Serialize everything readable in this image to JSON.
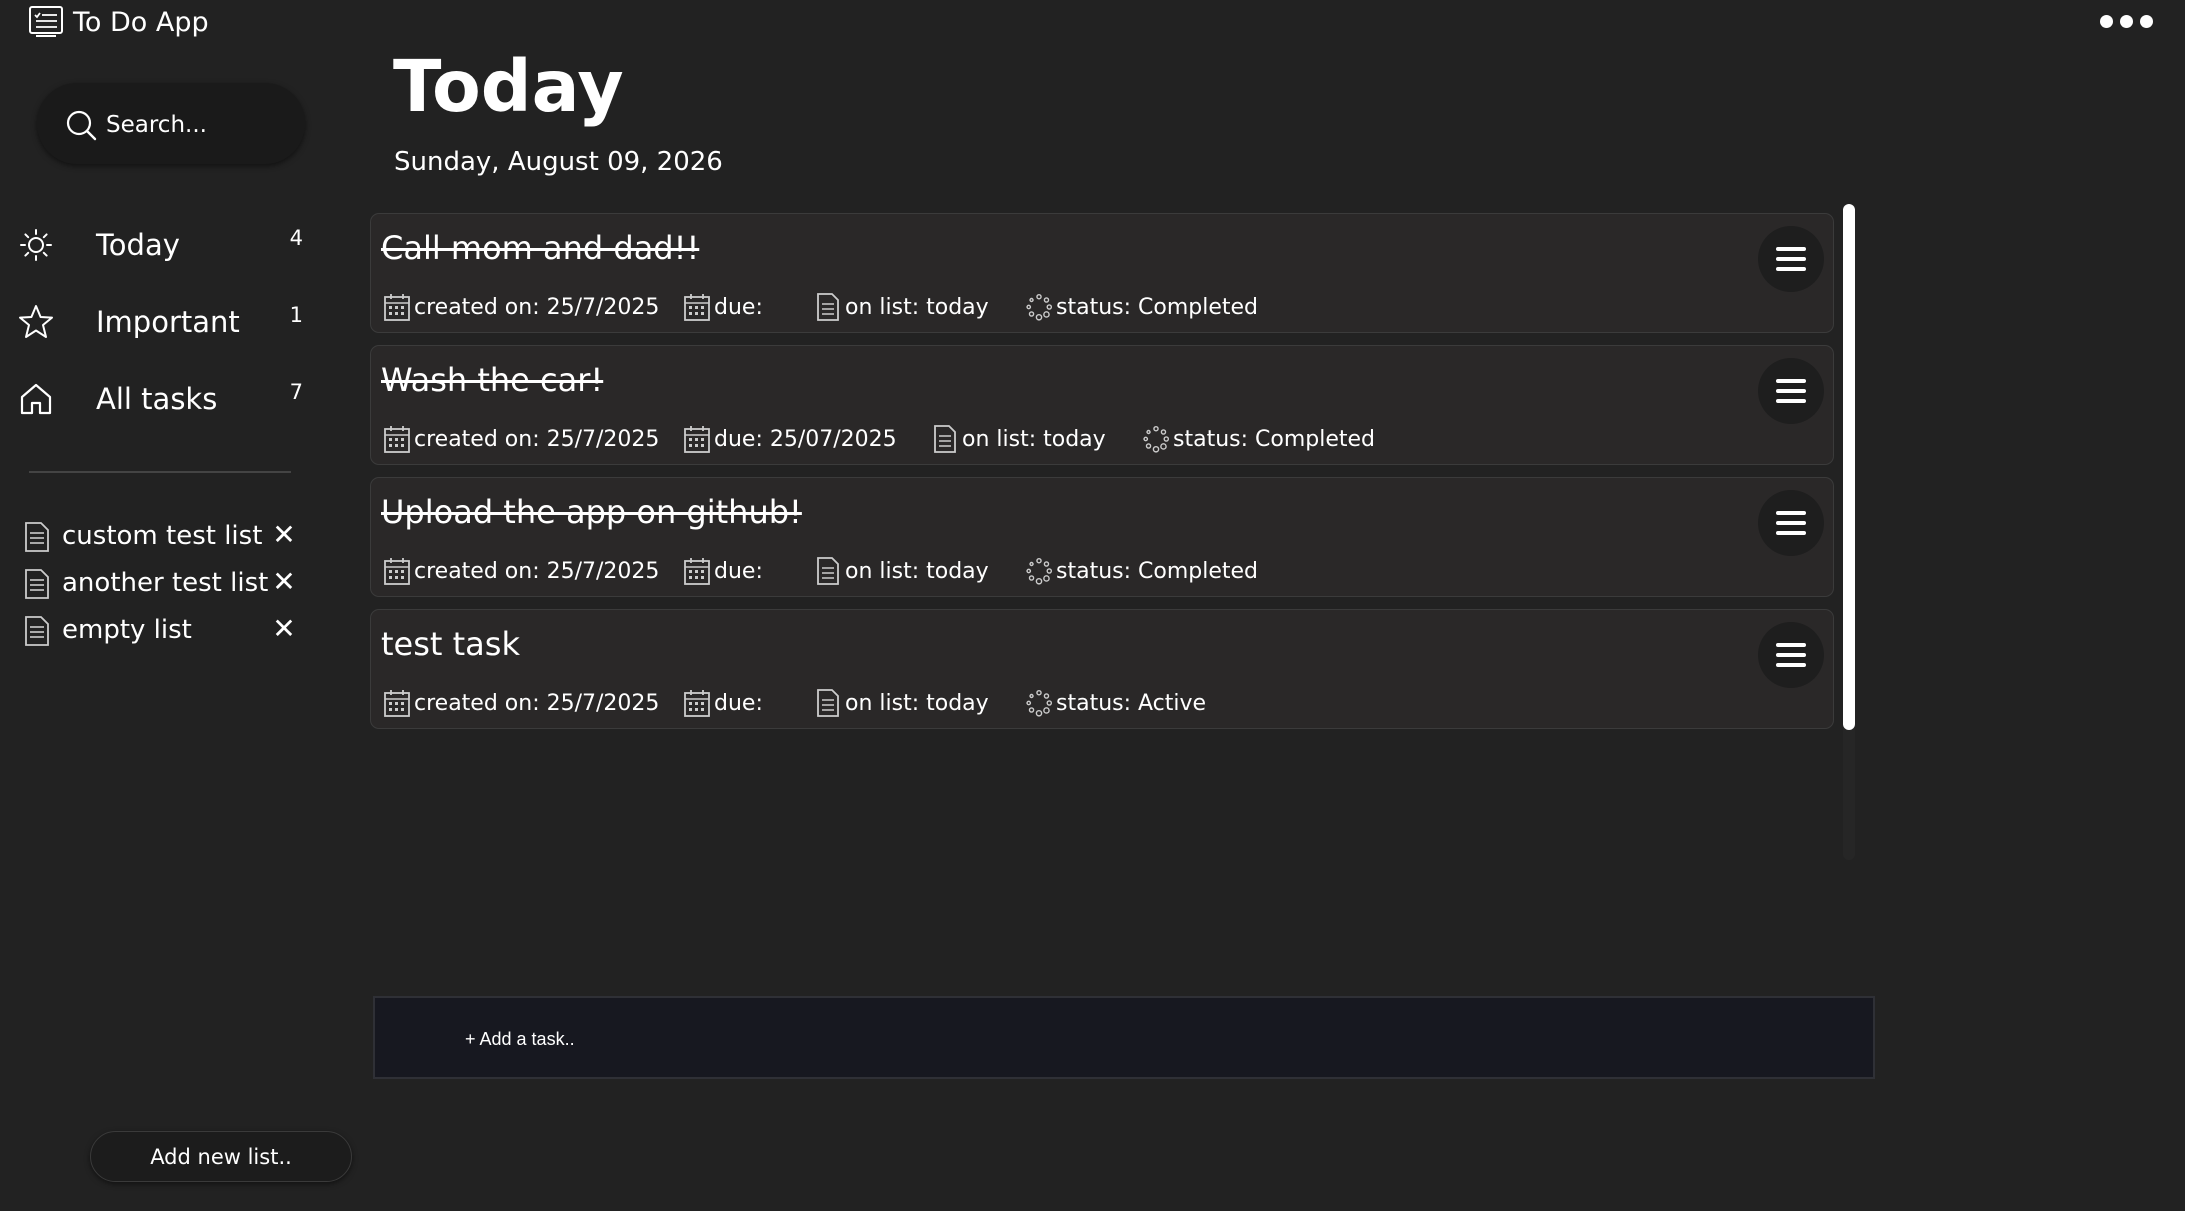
{
  "app": {
    "title": "To Do App",
    "app_icon": "checklist-window-icon",
    "menu_icon": "more-horizontal-icon"
  },
  "search": {
    "placeholder": "Search...",
    "value": "",
    "icon": "search-icon"
  },
  "nav": [
    {
      "label": "Today",
      "count": "4",
      "icon": "sun-icon"
    },
    {
      "label": "Important",
      "count": "1",
      "icon": "star-icon"
    },
    {
      "label": "All tasks",
      "count": "7",
      "icon": "home-icon"
    }
  ],
  "lists": [
    {
      "label": "custom test list",
      "remove": "✕",
      "icon": "document-icon"
    },
    {
      "label": "another test list",
      "remove": "✕",
      "icon": "document-icon"
    },
    {
      "label": "empty list",
      "remove": "✕",
      "icon": "document-icon"
    }
  ],
  "add_list_label": "Add new list..",
  "main": {
    "title": "Today",
    "date": "Sunday, August 09, 2026",
    "add_task_placeholder": "+ Add a task.."
  },
  "tasks": [
    {
      "title": "Call mom and dad!!",
      "completed": true,
      "created": "created on: 25/7/2025",
      "due": "due:",
      "list": "on list: today",
      "status": "status: Completed"
    },
    {
      "title": "Wash the car!",
      "completed": true,
      "created": "created on: 25/7/2025",
      "due": "due: 25/07/2025",
      "list": "on list: today",
      "status": "status: Completed"
    },
    {
      "title": "Upload the app on github!",
      "completed": true,
      "created": "created on: 25/7/2025",
      "due": "due:",
      "list": "on list: today",
      "status": "status: Completed"
    },
    {
      "title": "test task",
      "completed": false,
      "created": "created on: 25/7/2025",
      "due": "due:",
      "list": "on list: today",
      "status": "status: Active"
    }
  ],
  "colors": {
    "background": "#222222",
    "card": "#2a2828",
    "add_task_bar": "#171820",
    "text": "#ffffff"
  }
}
